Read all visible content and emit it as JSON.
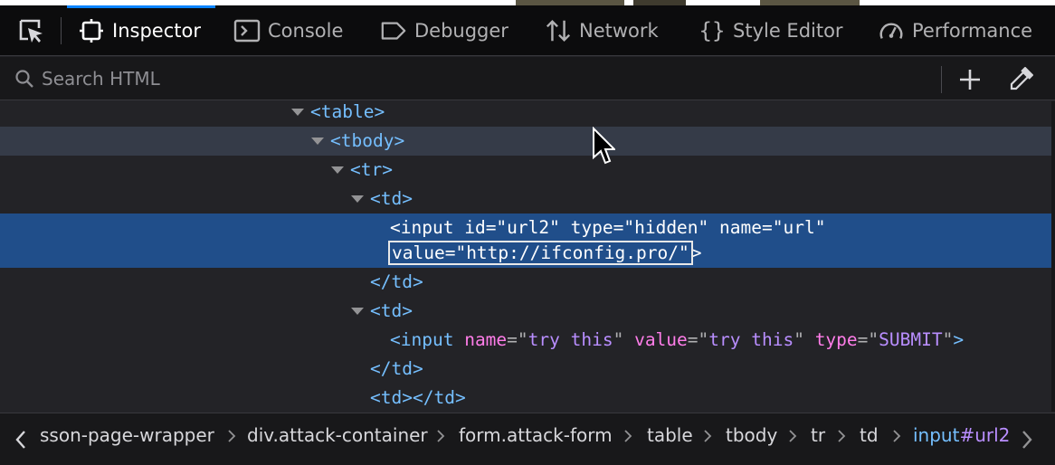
{
  "toolbar": {
    "tabs": [
      {
        "label": "Inspector",
        "icon": "inspector-icon"
      },
      {
        "label": "Console",
        "icon": "console-icon"
      },
      {
        "label": "Debugger",
        "icon": "debugger-icon"
      },
      {
        "label": "Network",
        "icon": "network-icon"
      },
      {
        "label": "Style Editor",
        "icon": "style-editor-icon"
      },
      {
        "label": "Performance",
        "icon": "performance-icon"
      }
    ],
    "active_tab": "Inspector",
    "picker_icon": "element-picker-icon"
  },
  "search": {
    "placeholder": "Search HTML",
    "value": ""
  },
  "markup": {
    "table": "table",
    "tbody": "tbody",
    "tr": "tr",
    "td": "td",
    "input1": {
      "tag": "input",
      "attrs": [
        {
          "name": "id",
          "value": "url2"
        },
        {
          "name": "type",
          "value": "hidden"
        },
        {
          "name": "name",
          "value": "url"
        }
      ],
      "value_attr": {
        "name": "value",
        "value": "http://ifconfig.pro/"
      }
    },
    "input2": {
      "tag": "input",
      "attrs": [
        {
          "name": "name",
          "value": "try this"
        },
        {
          "name": "value",
          "value": "try this"
        },
        {
          "name": "type",
          "value": "SUBMIT"
        }
      ]
    }
  },
  "breadcrumbs": {
    "items": [
      "sson-page-wrapper",
      "div.attack-container",
      "form.attack-form",
      "table",
      "tbody",
      "tr",
      "td"
    ],
    "selected_tag": "input",
    "selected_id": "#url2"
  },
  "colors": {
    "tag": "#75bfff",
    "attr_name": "#ff7de9",
    "attr_value": "#b98eff",
    "selection": "#204e8a",
    "hover": "#353b48",
    "active_tab": "#0a84ff"
  }
}
